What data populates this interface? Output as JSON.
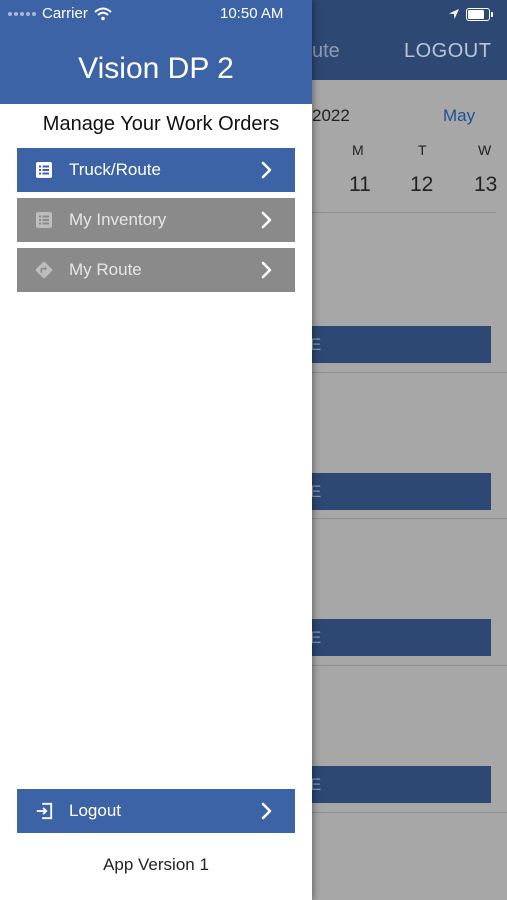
{
  "status_bar": {
    "carrier": "Carrier",
    "time": "10:50 AM"
  },
  "drawer": {
    "title": "Vision DP 2",
    "subtitle": "Manage Your Work Orders",
    "menu": [
      {
        "label": "Truck/Route",
        "icon": "list-icon",
        "state": "active"
      },
      {
        "label": "My Inventory",
        "icon": "list-icon",
        "state": "inactive"
      },
      {
        "label": "My Route",
        "icon": "directions-icon",
        "state": "inactive"
      }
    ],
    "logout_label": "Logout",
    "app_version": "App Version 1"
  },
  "background_screen": {
    "title_fragment": "ute",
    "logout_label": "LOGOUT",
    "calendar": {
      "year_fragment": "2022",
      "month": "May",
      "weekdays": [
        "M",
        "T",
        "W"
      ],
      "days": [
        "11",
        "12",
        "13"
      ]
    },
    "button_fragment": "E"
  },
  "colors": {
    "header_blue": "#3c63a5",
    "dark_blue": "#2c4873",
    "inactive_gray": "#8a8a8a"
  }
}
